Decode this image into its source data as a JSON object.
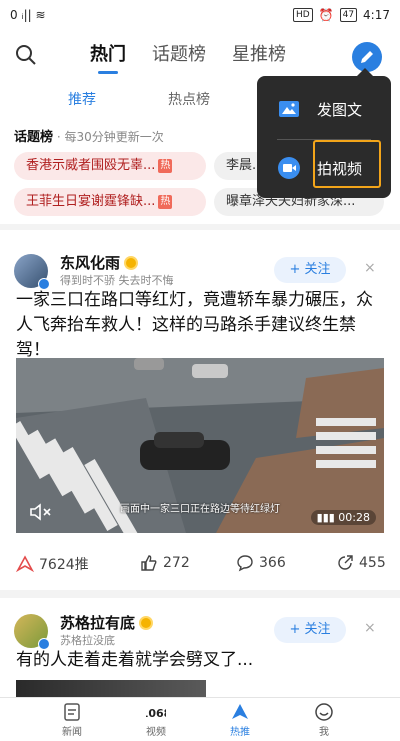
{
  "status": {
    "left": "0 ᵢ|| ≋",
    "hd": "HD",
    "battery": "47",
    "time": "4:17"
  },
  "header": {
    "tabs": [
      "热门",
      "话题榜",
      "星推榜"
    ]
  },
  "subtabs": [
    "推荐",
    "热点榜"
  ],
  "topics": {
    "title": "话题榜",
    "subtitle": " · 每30分钟更新一次",
    "hot_label": "热",
    "items": [
      "香港示威者围殴无辜...",
      "李晨...",
      "王菲生日宴谢霆锋缺...",
      "曝章泽天夫妇新家深..."
    ]
  },
  "popup": {
    "items": [
      "发图文",
      "拍视频"
    ]
  },
  "post1": {
    "user": "东风化雨",
    "subtitle": "得到时不骄 失去时不悔",
    "follow": "+ 关注",
    "close": "×",
    "text": "一家三口在路口等红灯，竟遭轿车暴力碾压，众人飞奔抬车救人！这样的马路杀手建议终生禁驾！",
    "video_caption": "画面中一家三口正在路边等待红绿灯",
    "duration": "00:28",
    "actions": {
      "push": "7624推",
      "like": "272",
      "comment": "366",
      "share": "455"
    }
  },
  "post2": {
    "user": "苏格拉有底",
    "subtitle": "苏格拉没底",
    "follow": "+ 关注",
    "close": "×",
    "text": "有的人走着走着就学会劈叉了..."
  },
  "bottom_nav": [
    "新闻",
    "视频",
    "热推",
    "我"
  ],
  "colors": {
    "accent": "#2a7fe0",
    "hot": "#f06a5a",
    "popup": "#2b2b2b",
    "highlight": "#f3a51a"
  }
}
